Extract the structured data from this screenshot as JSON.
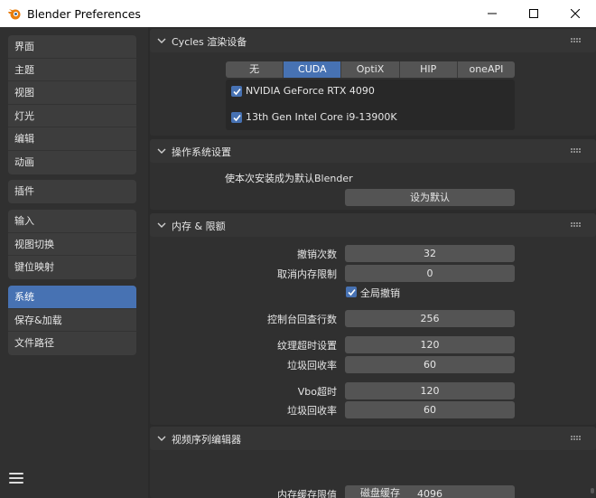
{
  "window": {
    "title": "Blender Preferences"
  },
  "sidebar": {
    "groups": [
      {
        "items": [
          {
            "label": "界面"
          },
          {
            "label": "主题"
          },
          {
            "label": "视图"
          },
          {
            "label": "灯光"
          },
          {
            "label": "编辑"
          },
          {
            "label": "动画"
          }
        ]
      },
      {
        "items": [
          {
            "label": "插件"
          }
        ]
      },
      {
        "items": [
          {
            "label": "输入"
          },
          {
            "label": "视图切换"
          },
          {
            "label": "键位映射"
          }
        ]
      },
      {
        "items": [
          {
            "label": "系统",
            "active": true
          },
          {
            "label": "保存&加载"
          },
          {
            "label": "文件路径"
          }
        ]
      }
    ]
  },
  "cycles": {
    "title": "Cycles 渲染设备",
    "tabs": [
      "无",
      "CUDA",
      "OptiX",
      "HIP",
      "oneAPI"
    ],
    "active_tab": "CUDA",
    "devices": [
      {
        "label": "NVIDIA GeForce RTX 4090",
        "checked": true
      },
      {
        "label": "13th Gen Intel Core i9-13900K",
        "checked": true
      }
    ]
  },
  "os_settings": {
    "title": "操作系统设置",
    "description": "使本次安装成为默认Blender",
    "button": "设为默认"
  },
  "memory": {
    "title": "内存 & 限额",
    "undo_steps_label": "撤销次数",
    "undo_steps": "32",
    "undo_memory_label": "取消内存限制",
    "undo_memory": "0",
    "global_undo_label": "全局撤销",
    "global_undo": true,
    "console_scrollback_label": "控制台回查行数",
    "console_scrollback": "256",
    "texture_timeout_label": "纹理超时设置",
    "texture_timeout": "120",
    "texture_gc_label": "垃圾回收率",
    "texture_gc": "60",
    "vbo_timeout_label": "Vbo超时",
    "vbo_timeout": "120",
    "vbo_gc_label": "垃圾回收率",
    "vbo_gc": "60"
  },
  "sequencer": {
    "title": "视频序列编辑器",
    "cache_limit_label": "内存缓存限值",
    "cache_limit": "4096",
    "disk_cache_label": "磁盘缓存",
    "disk_cache": false
  }
}
